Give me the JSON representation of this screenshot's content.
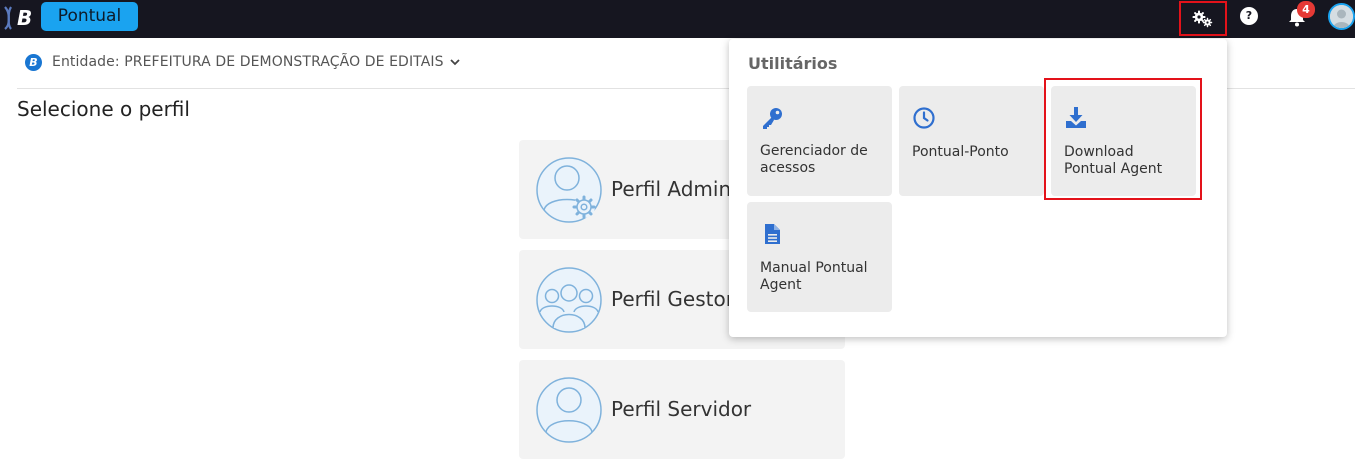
{
  "topbar": {
    "logo_letter": "B",
    "app_name": "Pontual",
    "help_glyph": "?",
    "notifications_count": "4",
    "colors": {
      "bar": "#161620",
      "accent": "#1aa3f0",
      "badge": "#e53935",
      "highlight": "#e3121a"
    }
  },
  "entity": {
    "icon_letter": "B",
    "label": "Entidade: PREFEITURA DE DEMONSTRAÇÃO DE EDITAIS"
  },
  "page_title": "Selecione o perfil",
  "profiles": [
    {
      "label": "Perfil Admini",
      "icon": "admin-user-gear-icon"
    },
    {
      "label": "Perfil Gestor",
      "icon": "group-users-icon"
    },
    {
      "label": "Perfil Servidor",
      "icon": "user-icon"
    }
  ],
  "utilities": {
    "title": "Utilitários",
    "items": [
      {
        "label": "Gerenciador de acessos",
        "icon": "key-icon"
      },
      {
        "label": "Pontual-Ponto",
        "icon": "clock-icon"
      },
      {
        "label": "Download Pontual Agent",
        "icon": "download-icon"
      },
      {
        "label": "Manual Pontual Agent",
        "icon": "document-icon"
      }
    ]
  }
}
